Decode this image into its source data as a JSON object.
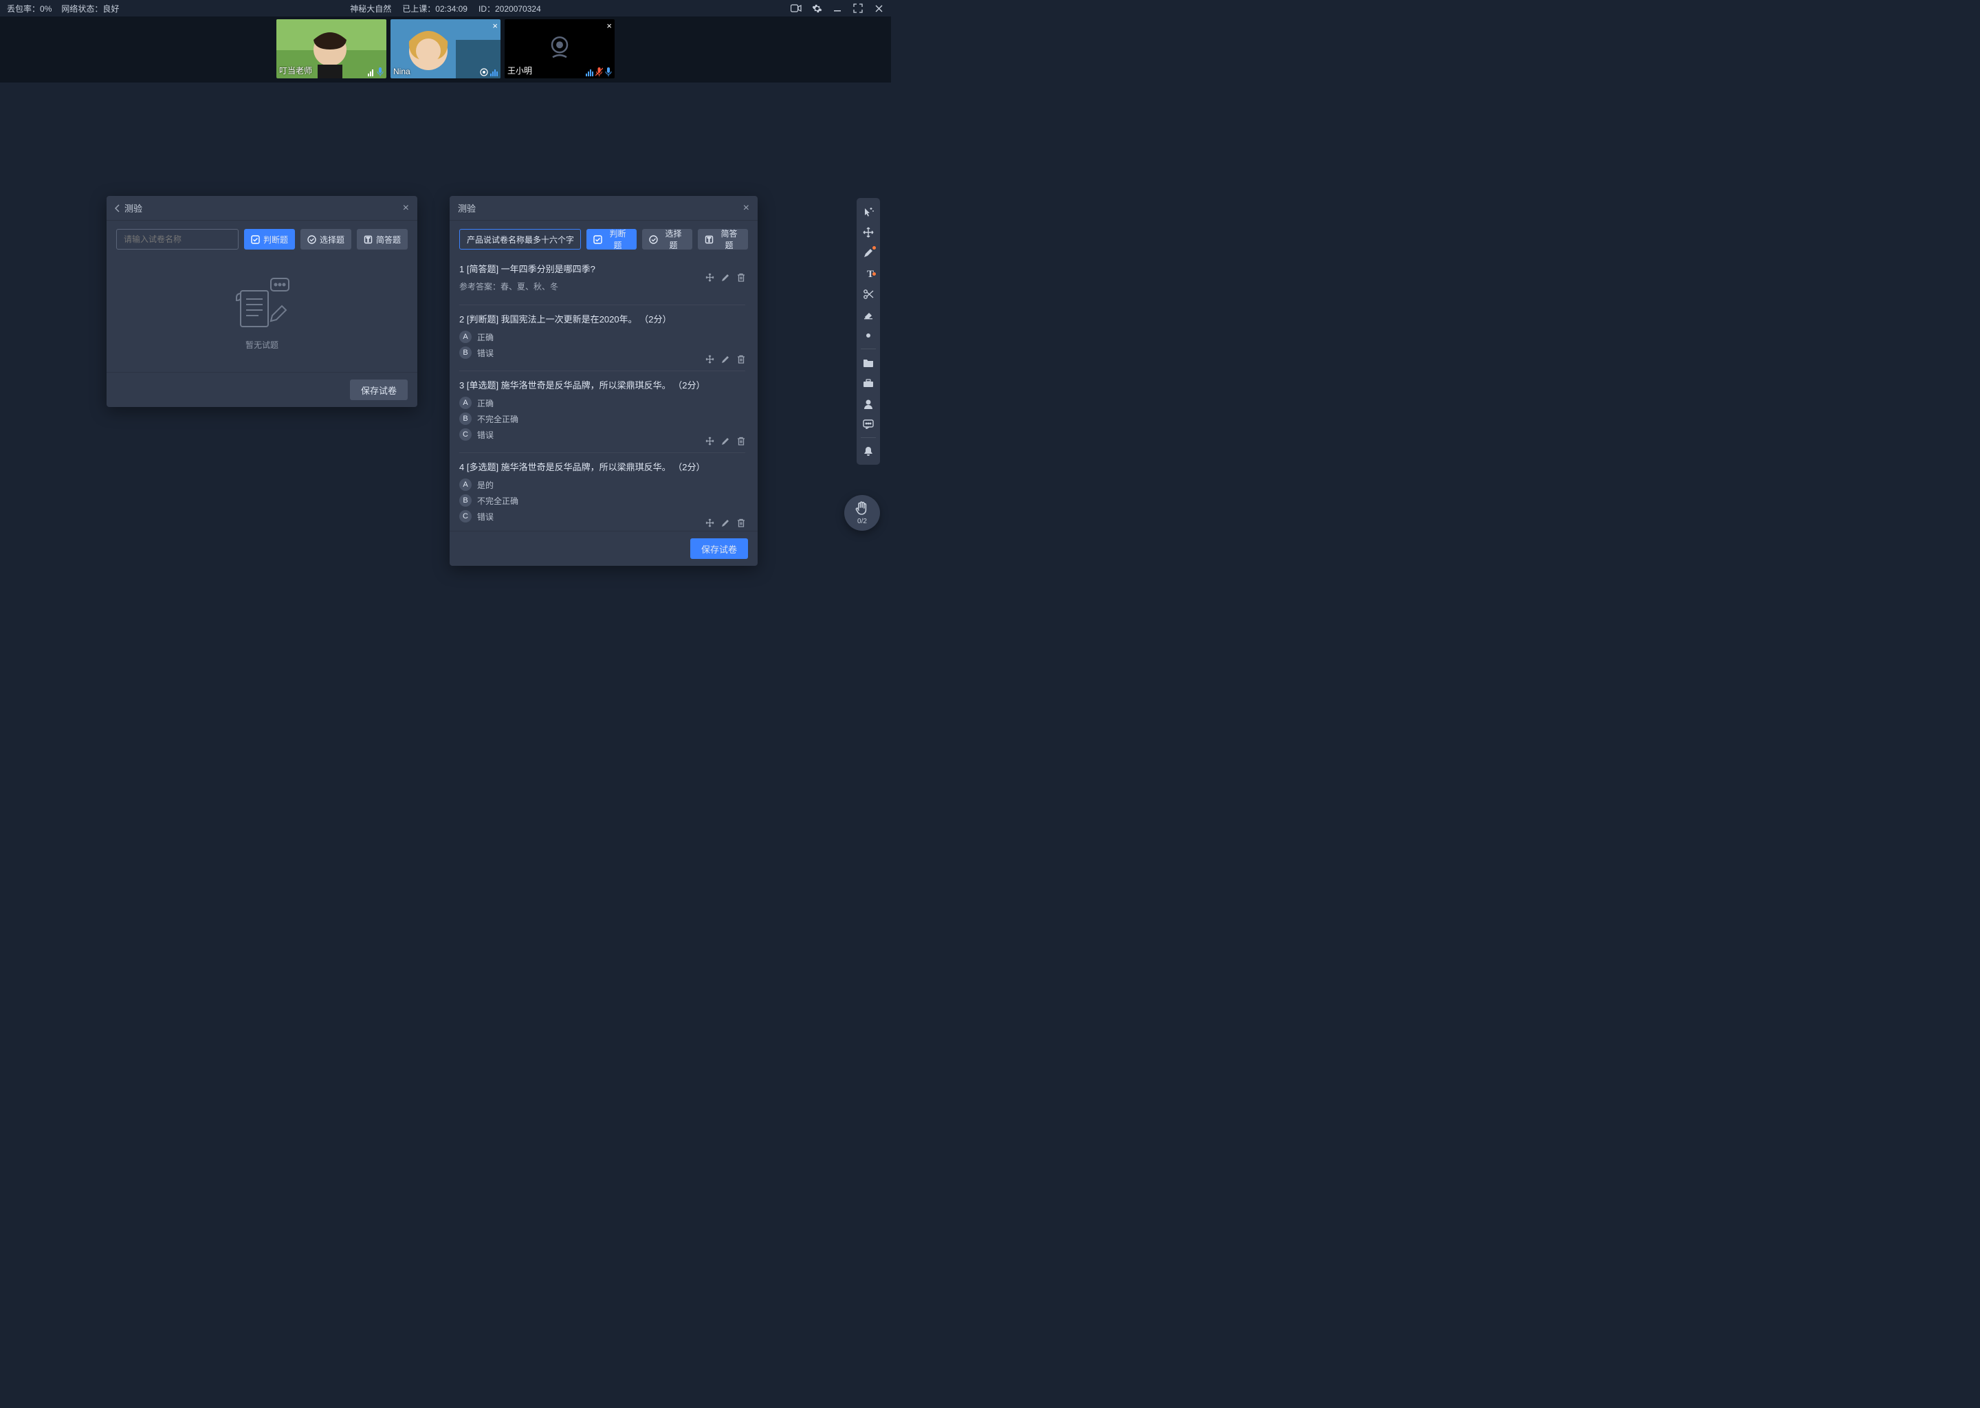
{
  "status": {
    "packet_loss_label": "丢包率：",
    "packet_loss_value": "0%",
    "network_label": "网络状态：",
    "network_value": "良好",
    "class_title": "神秘大自然",
    "elapsed_label": "已上课：",
    "elapsed_value": "02:34:09",
    "id_label": "ID：",
    "id_value": "2020070324"
  },
  "videos": [
    {
      "name": "叮当老师",
      "camera_on": true,
      "closeable": false
    },
    {
      "name": "Nina",
      "camera_on": true,
      "closeable": true
    },
    {
      "name": "王小明",
      "camera_on": false,
      "closeable": true
    }
  ],
  "panel_empty": {
    "title": "测验",
    "name_placeholder": "请输入试卷名称",
    "type_buttons": {
      "judge": "判断题",
      "choice": "选择题",
      "short": "简答题"
    },
    "empty_text": "暂无试题",
    "save_label": "保存试卷"
  },
  "panel_full": {
    "title": "测验",
    "name_value": "产品说试卷名称最多十六个字",
    "type_buttons": {
      "judge": "判断题",
      "choice": "选择题",
      "short": "简答题"
    },
    "save_label": "保存试卷",
    "questions": [
      {
        "number": "1",
        "tag": "[简答题]",
        "text": "一年四季分别是哪四季?",
        "answer_label": "参考答案：",
        "answer_text": "春、夏、秋、冬",
        "options": []
      },
      {
        "number": "2",
        "tag": "[判断题]",
        "text": "我国宪法上一次更新是在2020年。",
        "points": "（2分）",
        "options": [
          {
            "key": "A",
            "text": "正确"
          },
          {
            "key": "B",
            "text": "错误"
          }
        ]
      },
      {
        "number": "3",
        "tag": "[单选题]",
        "text": "施华洛世奇是反华品牌，所以梁鼎琪反华。",
        "points": "（2分）",
        "options": [
          {
            "key": "A",
            "text": "正确"
          },
          {
            "key": "B",
            "text": "不完全正确"
          },
          {
            "key": "C",
            "text": "错误"
          }
        ]
      },
      {
        "number": "4",
        "tag": "[多选题]",
        "text": "施华洛世奇是反华品牌，所以梁鼎琪反华。",
        "points": "（2分）",
        "options": [
          {
            "key": "A",
            "text": "是的"
          },
          {
            "key": "B",
            "text": "不完全正确"
          },
          {
            "key": "C",
            "text": "错误"
          }
        ]
      }
    ]
  },
  "hand": {
    "count": "0/2"
  },
  "icons": {
    "camera": "camera-icon",
    "settings": "gear-icon",
    "minimize": "minimize-icon",
    "fullscreen": "fullscreen-icon",
    "close": "close-icon"
  }
}
